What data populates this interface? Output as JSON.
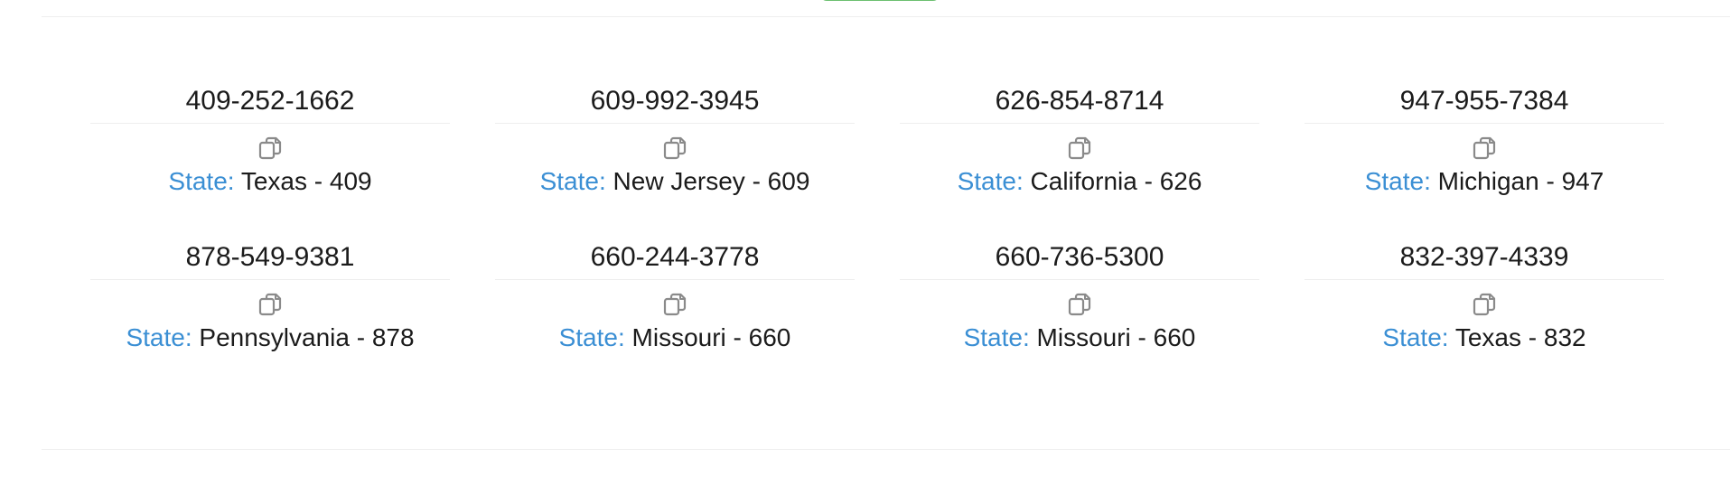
{
  "colors": {
    "accent_green": "#6cc070",
    "state_label_blue": "#3b8fd4",
    "text": "#1b1b1b",
    "divider": "#eeeeee",
    "icon_gray": "#8a8a8a"
  },
  "numbers": [
    {
      "phone": "409-252-1662",
      "state_label": "State:",
      "state_value": "Texas - 409",
      "icon": "copy-icon"
    },
    {
      "phone": "609-992-3945",
      "state_label": "State:",
      "state_value": "New Jersey - 609",
      "icon": "copy-icon"
    },
    {
      "phone": "626-854-8714",
      "state_label": "State:",
      "state_value": "California - 626",
      "icon": "copy-icon"
    },
    {
      "phone": "947-955-7384",
      "state_label": "State:",
      "state_value": "Michigan - 947",
      "icon": "copy-icon"
    },
    {
      "phone": "878-549-9381",
      "state_label": "State:",
      "state_value": "Pennsylvania - 878",
      "icon": "copy-icon"
    },
    {
      "phone": "660-244-3778",
      "state_label": "State:",
      "state_value": "Missouri - 660",
      "icon": "copy-icon"
    },
    {
      "phone": "660-736-5300",
      "state_label": "State:",
      "state_value": "Missouri - 660",
      "icon": "copy-icon"
    },
    {
      "phone": "832-397-4339",
      "state_label": "State:",
      "state_value": "Texas - 832",
      "icon": "copy-icon"
    }
  ]
}
